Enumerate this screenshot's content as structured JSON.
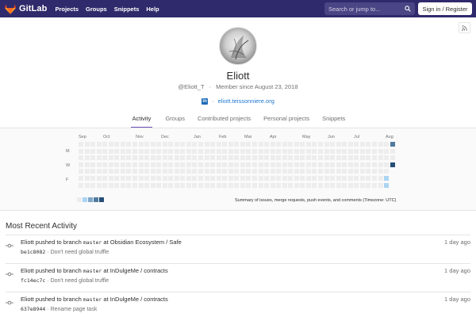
{
  "navbar": {
    "brand": "GitLab",
    "links": [
      "Projects",
      "Groups",
      "Snippets",
      "Help"
    ],
    "search_placeholder": "Search or jump to...",
    "signin_label": "Sign in / Register"
  },
  "profile": {
    "name": "Eliott",
    "username": "@Eliott_T",
    "member_since": "Member since August 23, 2018",
    "website": "eliott.teissonniere.org"
  },
  "tabs": [
    {
      "label": "Activity",
      "active": true
    },
    {
      "label": "Groups",
      "active": false
    },
    {
      "label": "Contributed projects",
      "active": false
    },
    {
      "label": "Personal projects",
      "active": false
    },
    {
      "label": "Snippets",
      "active": false
    }
  ],
  "calendar": {
    "months": [
      "Sep",
      "Oct",
      "Nov",
      "Dec",
      "Jan",
      "Feb",
      "Mar",
      "Apr",
      "May",
      "Jun",
      "Jul",
      "Aug"
    ],
    "day_labels": [
      "M",
      "W",
      "F"
    ],
    "summary": "Summary of issues, merge requests, push events, and comments (Timezone: UTC)",
    "colors": [
      "#ededed",
      "#acd5f2",
      "#7fa8c9",
      "#527ba0",
      "#254e77"
    ]
  },
  "activity": {
    "title": "Most Recent Activity",
    "events": [
      {
        "author": "Eliott",
        "action": "pushed to branch",
        "branch": "master",
        "at": "at",
        "project": "Obsidian Ecosystem / Safe",
        "sha": "be1c8082",
        "message": "Don't need global truffle",
        "time": "1 day ago"
      },
      {
        "author": "Eliott",
        "action": "pushed to branch",
        "branch": "master",
        "at": "at",
        "project": "InDulgeMe / contracts",
        "sha": "fc14ec7c",
        "message": "Don't need global truffle",
        "time": "1 day ago"
      },
      {
        "author": "Eliott",
        "action": "pushed to branch",
        "branch": "master",
        "at": "at",
        "project": "InDulgeMe / contracts",
        "sha": "637e8944",
        "message": "Rename page task",
        "time": "1 day ago"
      }
    ]
  }
}
